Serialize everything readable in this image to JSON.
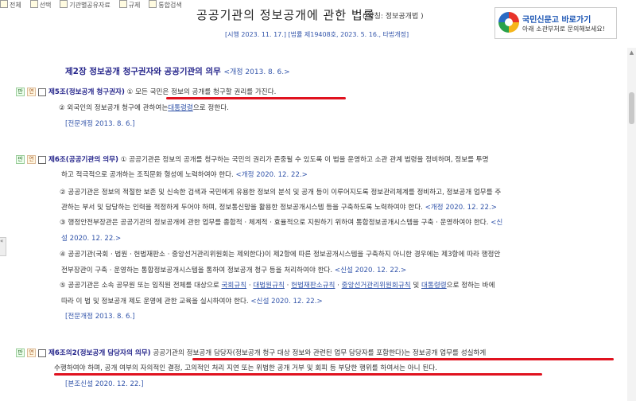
{
  "toolbar": {
    "items": [
      "전체",
      "선택",
      "기관별공유자료",
      "규제",
      "통합검색"
    ]
  },
  "law": {
    "title": "공공기관의 정보공개에 관한 법률",
    "abbreviation": "( 약칭: 정보공개법 )",
    "enforcement": "[시행 2023. 11. 17.] [법률 제19408호, 2023. 5. 16., 타법개정]"
  },
  "banner": {
    "title": "국민신문고 바로가기",
    "subtitle": "아래 소관부처로 문의해보세요!"
  },
  "chapter": {
    "title": "제2장 정보공개 청구권자와 공공기관의 의무",
    "revision": "<개정 2013. 8. 6.>"
  },
  "art5": {
    "icon1": "판",
    "icon2": "연",
    "title": "제5조(정보공개 청구권자)",
    "p1_num": "①",
    "p1": "모든 국민은 정보의 공개를 청구할 권리를 가진다.",
    "p2_pre": "② 외국인의 정보공개 청구에 관하여는",
    "p2_link": "대통령령",
    "p2_post": "으로 정한다.",
    "amend": "[전문개정 2013. 8. 6.]"
  },
  "art6": {
    "icon1": "판",
    "icon2": "연",
    "title": "제6조(공공기관의 의무)",
    "p1a": "① 공공기관은 정보의 공개를 청구하는 국민의 권리가 존중될 수 있도록 이 법을 운영하고 소관 관계 법령을 정비하며, 정보를 투명",
    "p1b": "하고 적극적으로 공개하는 조직문화 형성에 노력하여야 한다.",
    "p1b_rev": "<개정 2020. 12. 22.>",
    "p2a": "② 공공기관은 정보의 적절한 보존 및 신속한 검색과 국민에게 유용한 정보의 분석 및 공개 등이 이루어지도록 정보관리체계를 정비하고, 정보공개 업무를 주",
    "p2b": "관하는 부서 및 담당하는 인력을 적정하게 두어야 하며, 정보통신망을 활용한 정보공개시스템 등을 구축하도록 노력하여야 한다.",
    "p2b_rev": "<개정 2020. 12. 22.>",
    "p3a": "③ 행정안전부장관은 공공기관의 정보공개에 관한 업무를 종합적 · 체계적 · 효율적으로 지원하기 위하여 통합정보공개시스템을 구축 · 운영하여야 한다.",
    "p3a_rev": "<신",
    "p3b_rev": "설 2020. 12. 22.>",
    "p4a": "④ 공공기관(국회 · 법원 · 헌법재판소 · 중앙선거관리위원회는 제외한다)이 제2항에 따른 정보공개시스템을 구축하지 아니한 경우에는 제3항에 따라 행정안",
    "p4b": "전부장관이 구축 · 운영하는 통합정보공개시스템을 통하여 정보공개 청구 등을 처리하여야 한다.",
    "p4b_rev": "<신설 2020. 12. 22.>",
    "p5a_pre": "⑤ 공공기관은 소속 공무원 또는 임직원 전체를 대상으로",
    "p5a_links": [
      "국회규칙",
      "대법원규칙",
      "헌법재판소규칙",
      "중앙선거관리위원회규칙"
    ],
    "p5a_and": "및",
    "p5a_link_last": "대통령령",
    "p5a_post": "으로 정하는 바에",
    "p5b": "따라 이 법 및 정보공개 제도 운영에 관한 교육을 실시하여야 한다.",
    "p5b_rev": "<신설 2020. 12. 22.>",
    "amend": "[전문개정 2013. 8. 6.]"
  },
  "art6_2": {
    "icon1": "판",
    "icon2": "연",
    "title": "제6조의2(정보공개 담당자의 의무)",
    "p1a": "공공기관의 정보공개 담당자(정보공개 청구 대상 정보와 관련된 업무 담당자를 포함한다)는 정보공개 업무를 성실하게",
    "p1b": "수행하여야 하며, 공개 여부의 자의적인 결정, 고의적인 처리 지연 또는 위법한 공개 거부 및 회피 등 부당한 행위를 하여서는 아니 된다.",
    "amend": "[본조신설 2020. 12. 22.]"
  },
  "side_tab": "«",
  "colors": {
    "highlight": "#e0121f",
    "link": "#3355aa",
    "heading": "#23238a"
  }
}
